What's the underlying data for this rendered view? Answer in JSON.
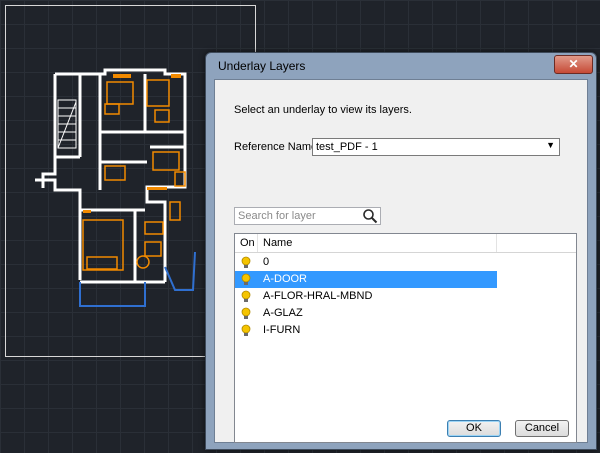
{
  "dialog": {
    "title": "Underlay Layers",
    "close_label": "✕",
    "instruction": "Select an underlay to view its layers.",
    "reference_label": "Reference Name:",
    "reference_value": "test_PDF - 1",
    "search_placeholder": "Search for layer",
    "columns": {
      "on": "On",
      "name": "Name"
    },
    "layers": [
      {
        "name": "0",
        "on": true,
        "selected": false
      },
      {
        "name": "A-DOOR",
        "on": true,
        "selected": true
      },
      {
        "name": "A-FLOR-HRAL-MBND",
        "on": true,
        "selected": false
      },
      {
        "name": "A-GLAZ",
        "on": true,
        "selected": false
      },
      {
        "name": "I-FURN",
        "on": true,
        "selected": false
      }
    ],
    "ok_label": "OK",
    "cancel_label": "Cancel"
  },
  "colors": {
    "selection": "#3399ff",
    "bulb": "#f5c400",
    "plan_walls": "#ffffff",
    "plan_furniture": "#f28a00",
    "plan_glazing": "#2f6fd0"
  },
  "icons": [
    "search-icon",
    "lightbulb-icon",
    "close-icon",
    "chevron-down-icon"
  ]
}
